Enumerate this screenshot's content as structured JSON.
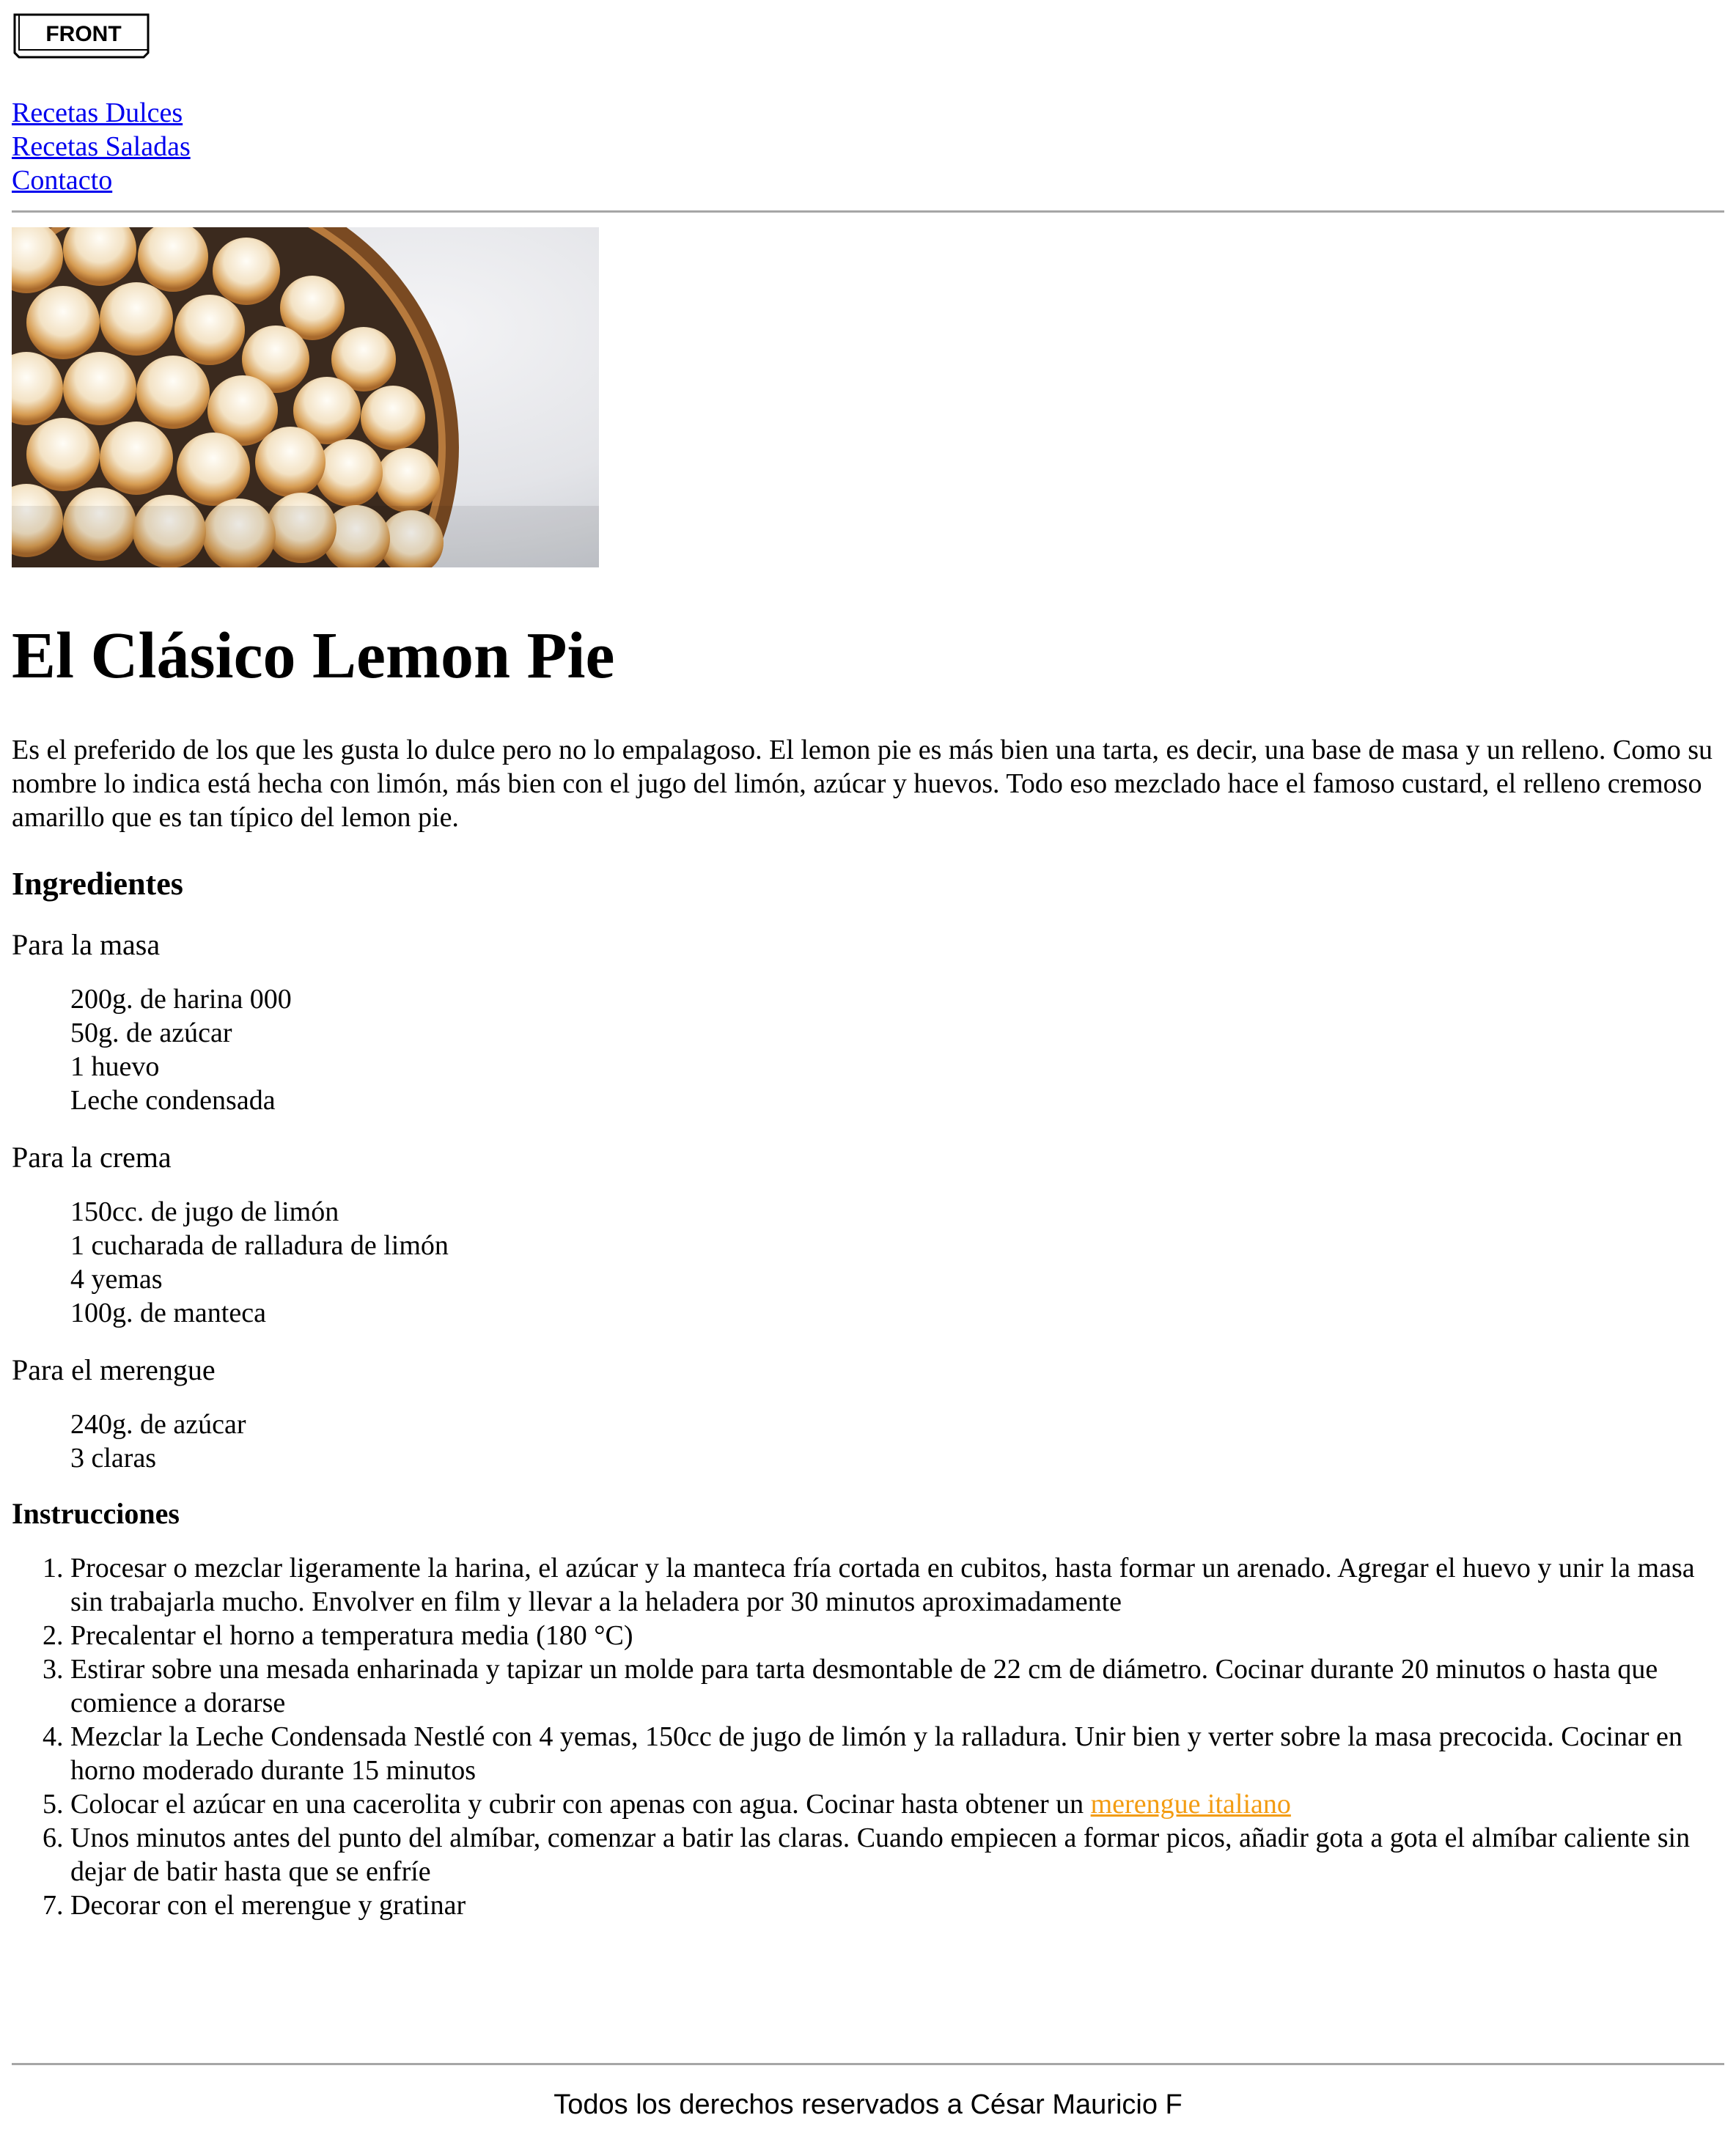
{
  "header": {
    "logo_text": "FRONT",
    "nav": [
      {
        "label": "Recetas Dulces"
      },
      {
        "label": "Recetas Saladas"
      },
      {
        "label": "Contacto"
      }
    ]
  },
  "article": {
    "title": "El Clásico Lemon Pie",
    "intro": "Es el preferido de los que les gusta lo dulce pero no lo empalagoso. El lemon pie es más bien una tarta, es decir, una base de masa y un relleno. Como su nombre lo indica está hecha con limón, más bien con el jugo del limón, azúcar y huevos. Todo eso mezclado hace el famoso custard, el relleno cremoso amarillo que es tan típico del lemon pie.",
    "ingredients_heading": "Ingredientes",
    "groups": [
      {
        "name": "Para la masa",
        "items": [
          "200g. de harina 000",
          "50g. de azúcar",
          "1 huevo",
          "Leche condensada"
        ]
      },
      {
        "name": "Para la crema",
        "items": [
          "150cc. de jugo de limón",
          "1 cucharada de ralladura de limón",
          "4 yemas",
          "100g. de manteca"
        ]
      },
      {
        "name": "Para el merengue",
        "items": [
          "240g. de azúcar",
          "3 claras"
        ]
      }
    ],
    "instructions_heading": "Instrucciones",
    "steps": [
      "Procesar o mezclar ligeramente la harina, el azúcar y la manteca fría cortada en cubitos, hasta formar un arenado. Agregar el huevo y unir la masa sin trabajarla mucho. Envolver en film y llevar a la heladera por 30 minutos aproximadamente",
      "Precalentar el horno a temperatura media (180 °C)",
      "Estirar sobre una mesada enharinada y tapizar un molde para tarta desmontable de 22 cm de diámetro. Cocinar durante 20 minutos o hasta que comience a dorarse",
      "Mezclar la Leche Condensada Nestlé con 4 yemas, 150cc de jugo de limón y la ralladura. Unir bien y verter sobre la masa precocida. Cocinar en horno moderado durante 15 minutos",
      "Colocar el azúcar en una cacerolita y cubrir con apenas con agua. Cocinar hasta obtener un ",
      "Unos minutos antes del punto del almíbar, comenzar a batir las claras. Cuando empiecen a formar picos, añadir gota a gota el almíbar caliente sin dejar de batir hasta que se enfríe",
      "Decorar con el merengue y gratinar"
    ],
    "step5_link": "merengue italiano"
  },
  "footer": {
    "text": "Todos los derechos reservados a César Mauricio F"
  },
  "colors": {
    "link": "#0000ee",
    "accent_link": "#f39c12",
    "rule": "#a6a6a6"
  }
}
